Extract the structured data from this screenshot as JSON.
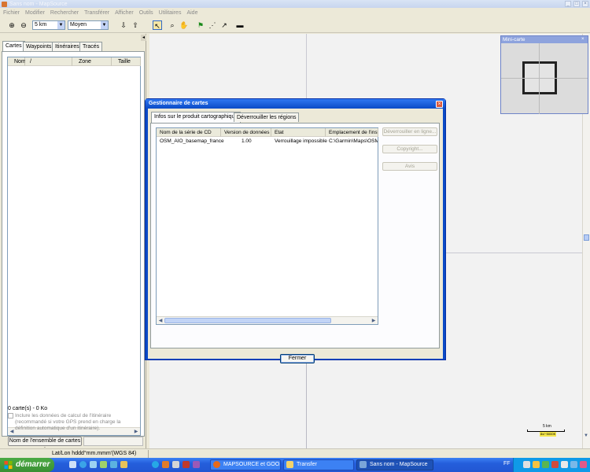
{
  "window": {
    "title": "Sans nom - MapSource"
  },
  "menu": [
    "Fichier",
    "Modifier",
    "Rechercher",
    "Transférer",
    "Afficher",
    "Outils",
    "Utilitaires",
    "Aide"
  ],
  "toolbar": {
    "zoom_value": "5 km",
    "detail_value": "Moyen"
  },
  "left_panel": {
    "tabs": [
      "Cartes",
      "Waypoints",
      "Itinéraires",
      "Tracés"
    ],
    "columns": [
      "Nom",
      "/",
      "Zone",
      "Taille"
    ],
    "count_text": "0 carte(s) - 0 Ko",
    "checkbox_label": "Inclure les données de calcul de l'itinéraire (recommandé si votre GPS prend en charge la définition automatique d'un itinéraire).",
    "set_button": "Nom de l'ensemble de cartes :"
  },
  "minimap": {
    "title": "Mini-carte"
  },
  "scale": {
    "label": "5 km",
    "badge": "8x/~5000ft"
  },
  "status": {
    "coord_format": "Lat/Lon hddd°mm.mmm'(WGS 84)"
  },
  "dialog": {
    "title": "Gestionnaire de cartes",
    "tabs": [
      "Infos sur le produit cartographique",
      "Déverrouiller les régions"
    ],
    "columns": [
      "Nom de la série de CD",
      "Version de données",
      "Etat",
      "Emplacement de l'insta"
    ],
    "rows": [
      {
        "name": "OSM_AIO_basemap_france",
        "version": "1.00",
        "state": "Verrouillage impossible",
        "location": "C:\\Garmin\\Maps\\OSM_"
      }
    ],
    "side_buttons": [
      "Déverrouiller en ligne...",
      "Copyright...",
      "Avis"
    ],
    "close_button": "Fermer"
  },
  "taskbar": {
    "start_label": "démarrer",
    "tasks": [
      "MAPSOURCE et GOO...",
      "Transfer",
      "Sans nom - MapSource"
    ],
    "language": "FF"
  }
}
